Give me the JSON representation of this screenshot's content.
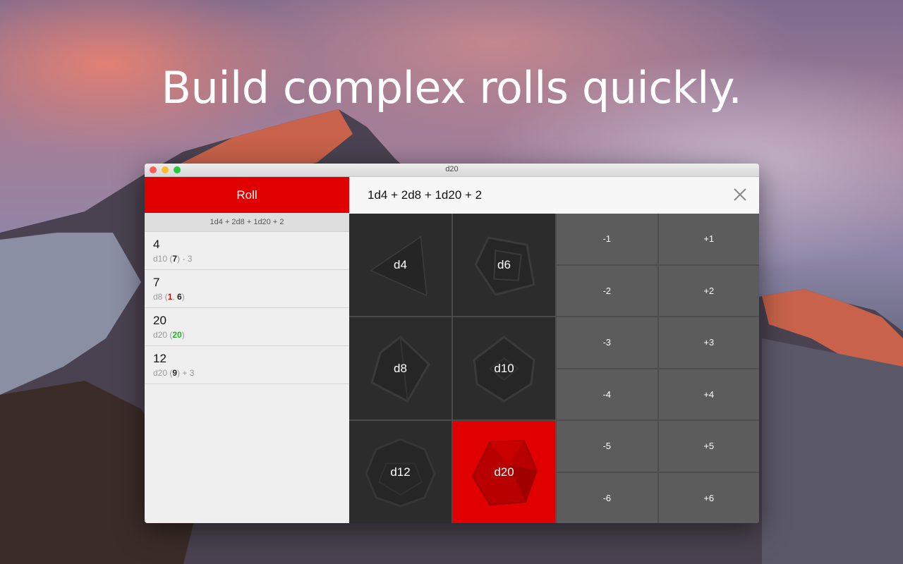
{
  "headline": "Build complex rolls quickly.",
  "window": {
    "title": "d20"
  },
  "sidebar": {
    "roll_label": "Roll",
    "last_formula": "1d4 + 2d8 + 1d20 + 2",
    "results": [
      {
        "total": "4",
        "die": "d10 (",
        "rolls": [
          {
            "v": "7",
            "kind": "normal"
          }
        ],
        "suffix": ") - 3"
      },
      {
        "total": "7",
        "die": "d8 (",
        "rolls": [
          {
            "v": "1",
            "kind": "low"
          },
          {
            "v": "6",
            "kind": "normal"
          }
        ],
        "suffix": ")"
      },
      {
        "total": "20",
        "die": "d20 (",
        "rolls": [
          {
            "v": "20",
            "kind": "high"
          }
        ],
        "suffix": ")"
      },
      {
        "total": "12",
        "die": "d20 (",
        "rolls": [
          {
            "v": "9",
            "kind": "normal"
          }
        ],
        "suffix": ") + 3"
      }
    ]
  },
  "formula": {
    "text": "1d4 + 2d8 + 1d20 + 2"
  },
  "dice": [
    {
      "label": "d4",
      "icon": "d4-die-icon"
    },
    {
      "label": "d6",
      "icon": "d6-die-icon"
    },
    {
      "label": "d8",
      "icon": "d8-die-icon"
    },
    {
      "label": "d10",
      "icon": "d10-die-icon"
    },
    {
      "label": "d12",
      "icon": "d12-die-icon"
    },
    {
      "label": "d20",
      "icon": "d20-die-icon",
      "selected": true
    }
  ],
  "modifiers": [
    "-1",
    "+1",
    "-2",
    "+2",
    "-3",
    "+3",
    "-4",
    "+4",
    "-5",
    "+5",
    "-6",
    "+6"
  ],
  "colors": {
    "accent": "#e00000",
    "high_roll": "#1fb61f",
    "low_roll": "#e00000"
  }
}
